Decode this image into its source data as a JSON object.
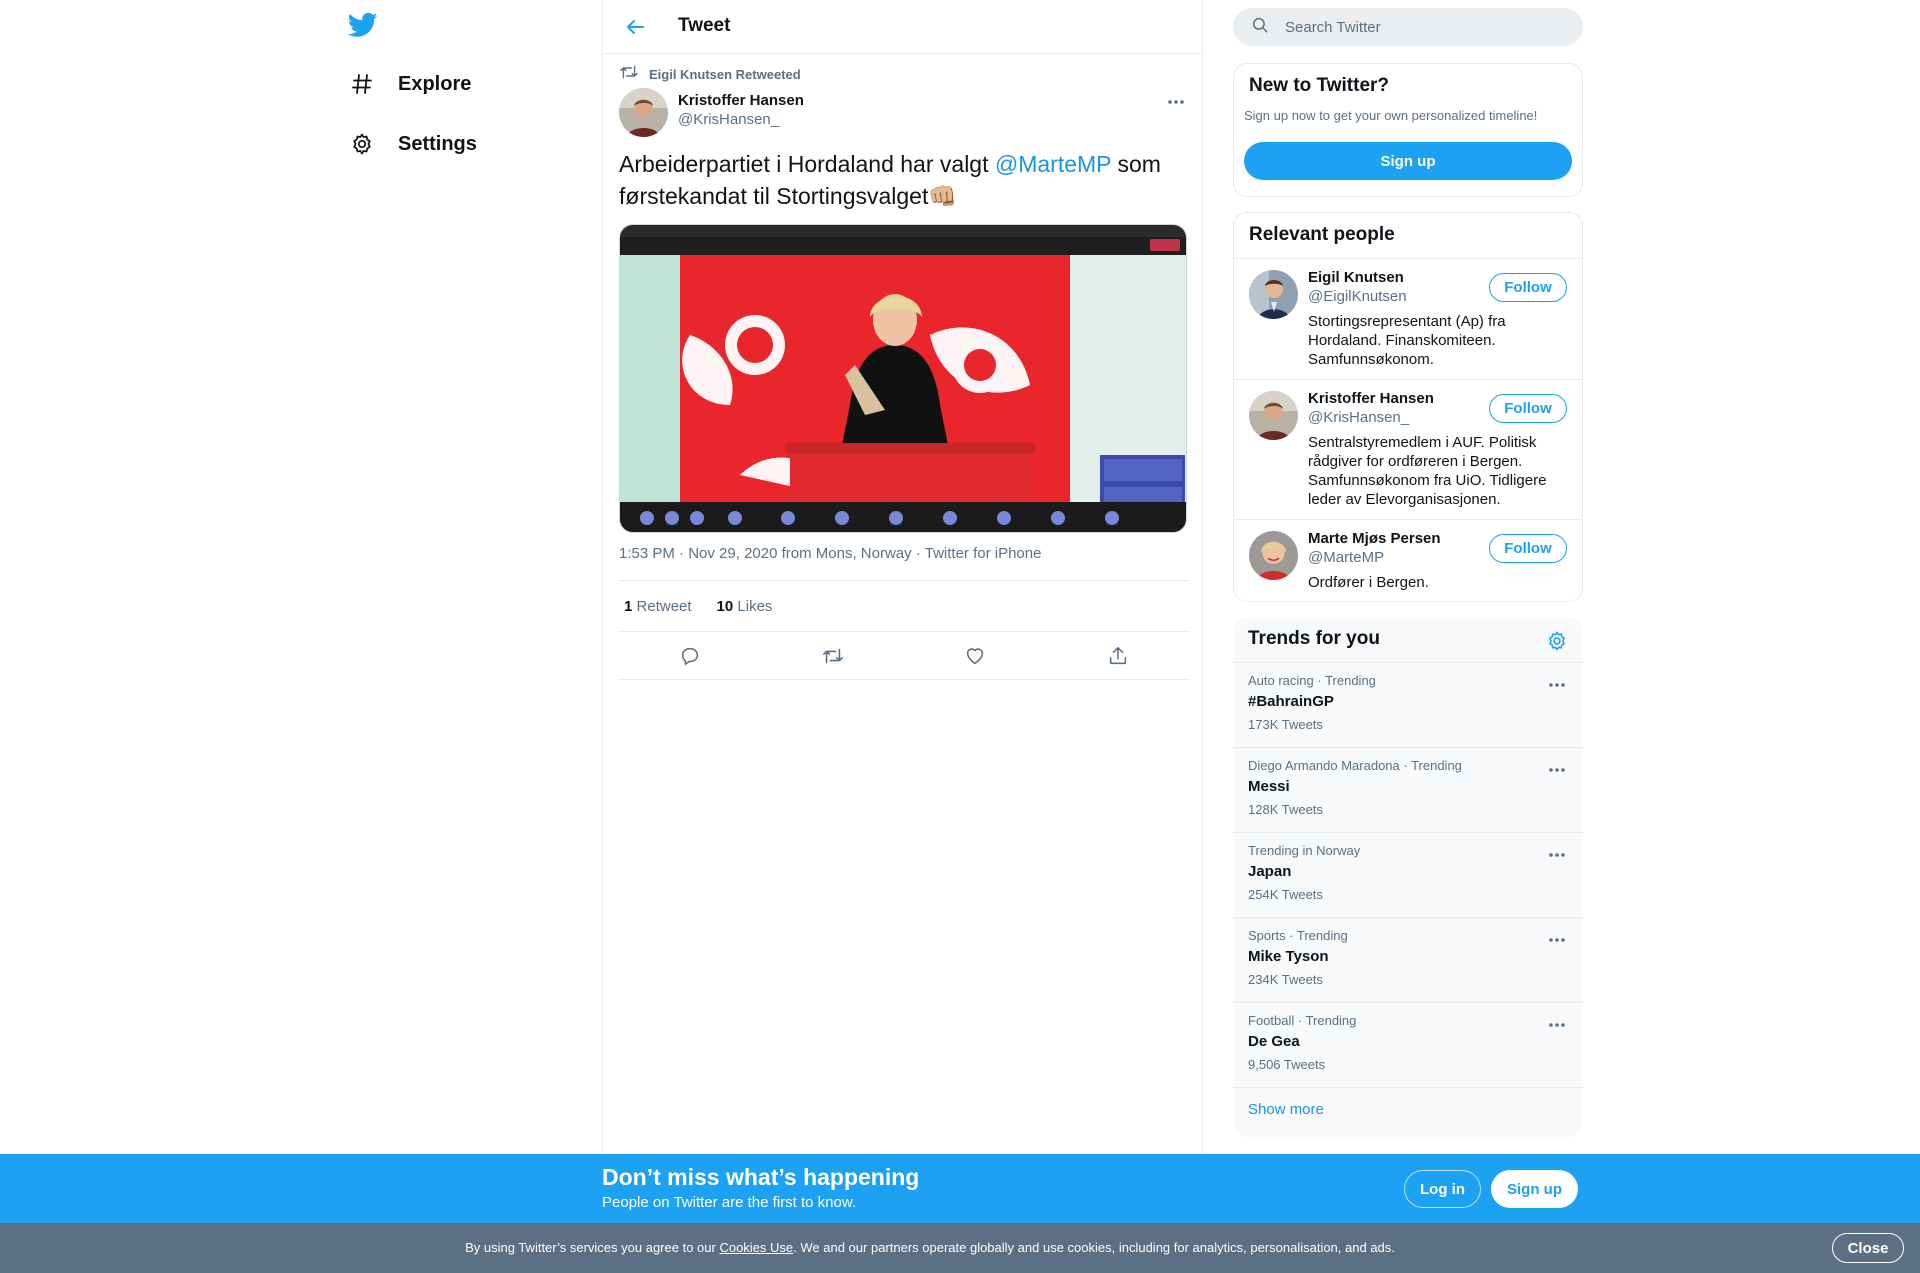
{
  "colors": {
    "accent": "#1da1f2",
    "link": "#1b95e0",
    "muted": "#5b7083",
    "border": "#e6ecf0",
    "cookie_bg": "#5b7083"
  },
  "nav": {
    "logo_icon": "twitter-bird-icon",
    "items": [
      {
        "label": "Explore",
        "icon": "hashtag-icon"
      },
      {
        "label": "Settings",
        "icon": "gear-icon"
      }
    ]
  },
  "header": {
    "title": "Tweet",
    "back_icon": "back-arrow-icon"
  },
  "tweet": {
    "retweeted_by": "Eigil Knutsen Retweeted",
    "author_name": "Kristoffer Hansen",
    "author_handle": "@KrisHansen_",
    "text_before": "Arbeiderpartiet i Hordaland har valgt ",
    "mention": "@MarteMP",
    "text_after": " som førstekandat til Stortingsvalget",
    "emoji": "👊🏼",
    "time": "1:53 PM",
    "date": "Nov 29, 2020",
    "location": "from Mons, Norway",
    "source": "Twitter for iPhone",
    "separator": "·",
    "retweet_count": "1",
    "retweet_label": "Retweet",
    "like_count": "10",
    "like_label": "Likes"
  },
  "search": {
    "placeholder": "Search Twitter"
  },
  "new_to_twitter": {
    "title": "New to Twitter?",
    "subtitle": "Sign up now to get your own personalized timeline!",
    "button": "Sign up"
  },
  "relevant_people": {
    "title": "Relevant people",
    "follow_label": "Follow",
    "people": [
      {
        "name": "Eigil Knutsen",
        "handle": "@EigilKnutsen",
        "bio": "Stortingsrepresentant (Ap) fra Hordaland. Finanskomiteen. Samfunnsøkonom."
      },
      {
        "name": "Kristoffer Hansen",
        "handle": "@KrisHansen_",
        "bio": "Sentralstyremedlem i AUF. Politisk rådgiver for ordføreren i Bergen. Samfunnsøkonom fra UiO. Tidligere leder av Elevorganisasjonen."
      },
      {
        "name": "Marte Mjøs Persen",
        "handle": "@MarteMP",
        "bio": "Ordfører i Bergen."
      }
    ]
  },
  "trends": {
    "title": "Trends for you",
    "items": [
      {
        "context": "Auto racing · Trending",
        "name": "#BahrainGP",
        "count": "173K Tweets"
      },
      {
        "context": "Diego Armando Maradona · Trending",
        "name": "Messi",
        "count": "128K Tweets"
      },
      {
        "context": "Trending in Norway",
        "name": "Japan",
        "count": "254K Tweets"
      },
      {
        "context": "Sports · Trending",
        "name": "Mike Tyson",
        "count": "234K Tweets"
      },
      {
        "context": "Football · Trending",
        "name": "De Gea",
        "count": "9,506 Tweets"
      }
    ],
    "show_more": "Show more"
  },
  "banner": {
    "title": "Don’t miss what’s happening",
    "subtitle": "People on Twitter are the first to know.",
    "login": "Log in",
    "signup": "Sign up"
  },
  "cookie": {
    "text_before": "By using Twitter’s services you agree to our ",
    "link": "Cookies Use",
    "text_after": ". We and our partners operate globally and use cookies, including for analytics, personalisation, and ads.",
    "close": "Close"
  }
}
